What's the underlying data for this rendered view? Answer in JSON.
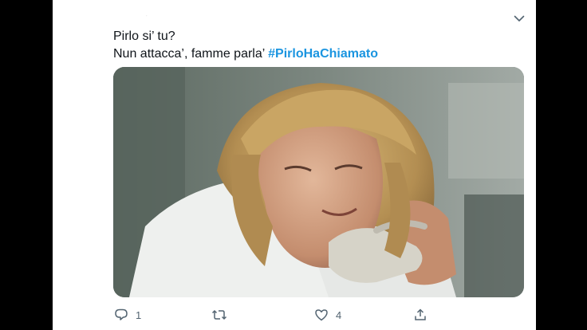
{
  "tweet": {
    "text_line1": "Pirlo si’ tu?",
    "text_line2_prefix": "Nun attacca’, famme parla’ ",
    "hashtag": "#PirloHaChiamato",
    "media_description_icon": "video-still-image",
    "caret_icon": "chevron-down-icon"
  },
  "actions": {
    "reply": {
      "icon": "reply-icon",
      "count": "1"
    },
    "retweet": {
      "icon": "retweet-icon",
      "count": ""
    },
    "like": {
      "icon": "heart-icon",
      "count": "4"
    },
    "share": {
      "icon": "share-icon",
      "count": ""
    }
  },
  "colors": {
    "background": "#000000",
    "card": "#ffffff",
    "text": "#0f1419",
    "hashtag": "#1b95e0",
    "icon": "#536471"
  }
}
